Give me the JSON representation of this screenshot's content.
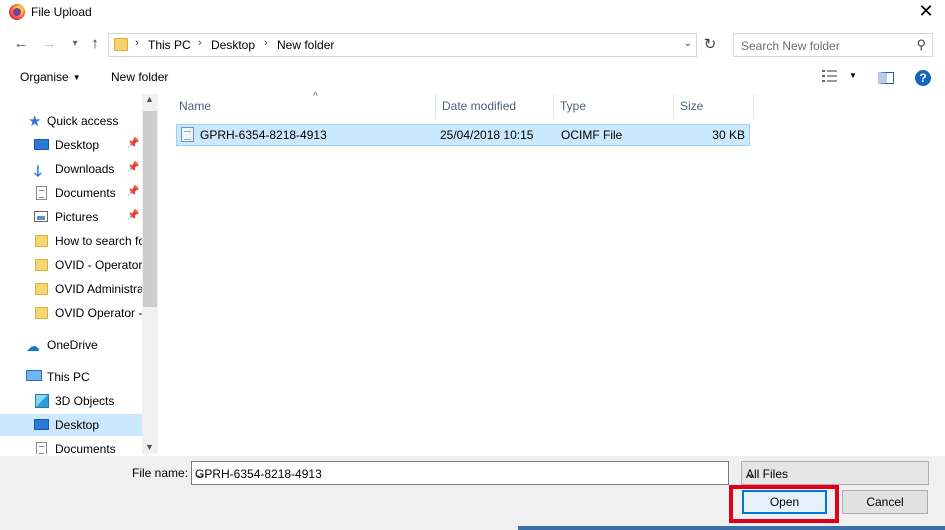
{
  "window": {
    "title": "File Upload"
  },
  "address": {
    "crumbs": [
      "This PC",
      "Desktop",
      "New folder"
    ]
  },
  "search": {
    "placeholder": "Search New folder"
  },
  "toolbar": {
    "organise_label": "Organise",
    "new_folder_label": "New folder"
  },
  "navpane": {
    "items": [
      {
        "label": "Quick access",
        "icon": "star-icon"
      },
      {
        "label": "Desktop",
        "icon": "desktop-icon",
        "pinned": true
      },
      {
        "label": "Downloads",
        "icon": "download-icon",
        "pinned": true
      },
      {
        "label": "Documents",
        "icon": "documents-icon",
        "pinned": true
      },
      {
        "label": "Pictures",
        "icon": "pictures-icon",
        "pinned": true
      },
      {
        "label": "How to search fo",
        "icon": "folder-icon"
      },
      {
        "label": "OVID - Operator",
        "icon": "folder-icon"
      },
      {
        "label": "OVID Administrat",
        "icon": "folder-icon"
      },
      {
        "label": "OVID Operator -",
        "icon": "folder-icon"
      },
      {
        "label": "OneDrive",
        "icon": "cloud-icon"
      },
      {
        "label": "This PC",
        "icon": "pc-icon"
      },
      {
        "label": "3D Objects",
        "icon": "3d-objects-icon"
      },
      {
        "label": "Desktop",
        "icon": "desktop-icon",
        "selected": true
      },
      {
        "label": "Documents",
        "icon": "documents-icon"
      }
    ]
  },
  "filelist": {
    "columns": [
      "Name",
      "Date modified",
      "Type",
      "Size"
    ],
    "rows": [
      {
        "name": "GPRH-6354-8218-4913",
        "date": "25/04/2018 10:15",
        "type": "OCIMF File",
        "size": "30 KB",
        "selected": true
      }
    ]
  },
  "bottom": {
    "filename_label": "File name:",
    "filename_value": "GPRH-6354-8218-4913",
    "filetype_value": "All Files",
    "open_label": "Open",
    "cancel_label": "Cancel"
  },
  "colors": {
    "selection": "#cce8ff",
    "highlight_border": "#e0001b",
    "accent": "#0078d7"
  }
}
